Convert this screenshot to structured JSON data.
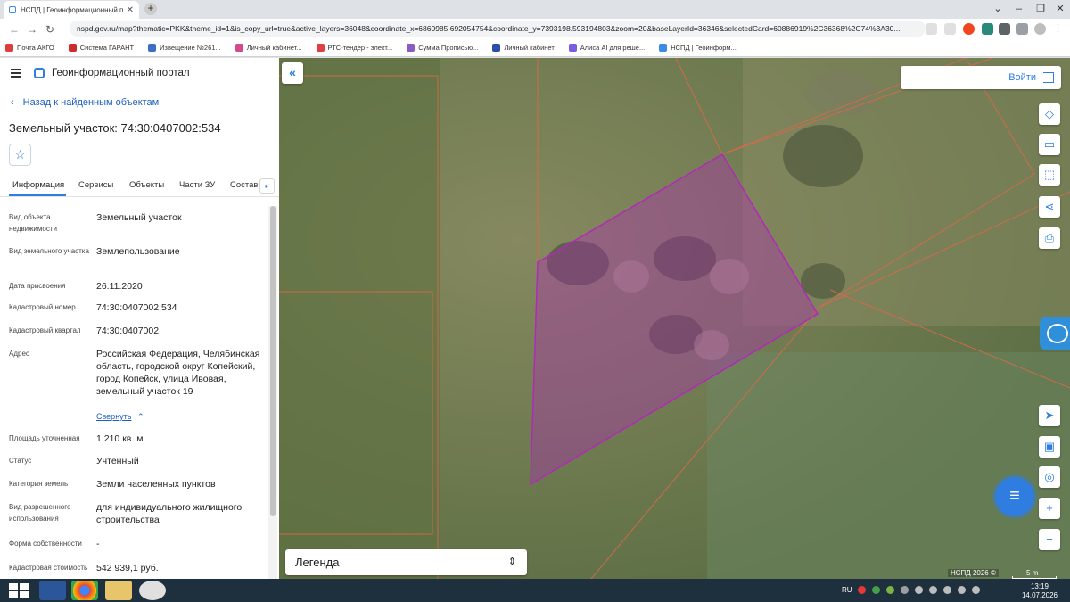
{
  "browser": {
    "tab_title": "НСПД | Геоинформационный п",
    "url": "nspd.gov.ru/map?thematic=PKK&theme_id=1&is_copy_url=true&active_layers=36048&coordinate_x=6860985.692054754&coordinate_y=7393198.593194803&zoom=20&baseLayerId=36346&selectedCard=60886919%2C36368%2C74%3A30..."
  },
  "bookmarks": [
    {
      "label": "Почта АКГО",
      "color": "#e23b3b"
    },
    {
      "label": "Система ГАРАНТ",
      "color": "#d22b2b"
    },
    {
      "label": "Извещение №261...",
      "color": "#3a6fc4"
    },
    {
      "label": "Личный кабинет...",
      "color": "#d44a8a"
    },
    {
      "label": "РТС-тендер - элект...",
      "color": "#e04040"
    },
    {
      "label": "Сумма Прописью...",
      "color": "#8a5cc2"
    },
    {
      "label": "Личный кабинет",
      "color": "#2b4fa8"
    },
    {
      "label": "Алиса AI для реше...",
      "color": "#7b5ce0"
    },
    {
      "label": "НСПД | Геоинформ...",
      "color": "#3a8de0"
    }
  ],
  "portal": {
    "title": "Геоинформационный портал",
    "back_label": "Назад к найденным объектам",
    "object_title": "Земельный участок: 74:30:0407002:534"
  },
  "tabs": [
    "Информация",
    "Сервисы",
    "Объекты",
    "Части ЗУ",
    "Состав"
  ],
  "info": {
    "object_type_label": "Вид объекта недвижимости",
    "object_type_value": "Земельный участок",
    "land_type_label": "Вид земельного участка",
    "land_type_value": "Землепользование",
    "date_label": "Дата присвоения",
    "date_value": "26.11.2020",
    "cadastral_number_label": "Кадастровый номер",
    "cadastral_number_value": "74:30:0407002:534",
    "cadastral_quarter_label": "Кадастровый квартал",
    "cadastral_quarter_value": "74:30:0407002",
    "address_label": "Адрес",
    "address_value": "Российская Федерация, Челябинская область, городской округ Копейский, город Копейск, улица Ивовая, земельный участок 19",
    "collapse_label": "Свернуть",
    "area_label": "Площадь уточненная",
    "area_value": "1 210 кв. м",
    "status_label": "Статус",
    "status_value": "Учтенный",
    "category_label": "Категория земель",
    "category_value": "Земли населенных пунктов",
    "permitted_use_label": "Вид разрешенного использования",
    "permitted_use_value": "для индивидуального жилищного строительства",
    "ownership_label": "Форма собственности",
    "ownership_value": "-",
    "cadastral_value_label": "Кадастровая стоимость",
    "cadastral_value_value": "542 939,1 руб."
  },
  "map": {
    "login_label": "Войти",
    "legend_label": "Легенда",
    "attribution": "НСПД 2026 ©",
    "scale_label": "5 m",
    "parcel_color": "#b02ab8"
  },
  "taskbar": {
    "language": "RU",
    "time": "13:19",
    "date": "14.07.2026"
  }
}
